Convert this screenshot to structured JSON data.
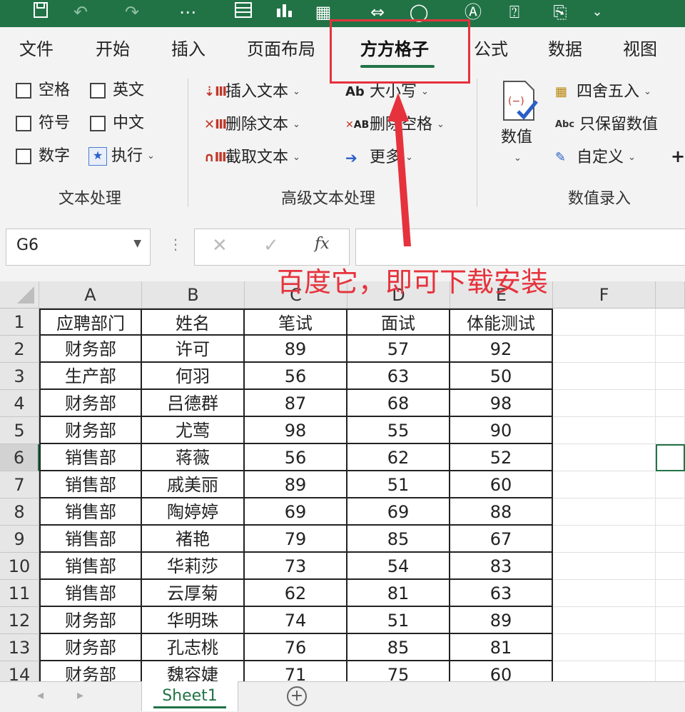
{
  "ribbon_tabs": [
    "文件",
    "开始",
    "插入",
    "页面布局",
    "方方格子",
    "公式",
    "数据",
    "视图"
  ],
  "active_tab": "方方格子",
  "ribbon": {
    "text_group": {
      "label": "文本处理",
      "checkboxes": [
        "空格",
        "英文",
        "符号",
        "中文",
        "数字"
      ],
      "execute_label": "执行"
    },
    "advanced_group": {
      "label": "高级文本处理",
      "insert_text": "插入文本",
      "delete_text": "删除文本",
      "extract_text": "截取文本",
      "case_label": "大小写",
      "delete_space": "删除空格",
      "more": "更多",
      "ab_glyph": "Ab",
      "ab_glyph2": "AB"
    },
    "number_group": {
      "label": "数值录入",
      "value_label": "数值",
      "round": "四舍五入",
      "keep_numbers": "只保留数值",
      "custom": "自定义",
      "plus": "+",
      "abc_glyph": "Abc"
    }
  },
  "name_box": "G6",
  "formula_bar": {
    "cancel": "✕",
    "confirm": "✓",
    "fx": "fx",
    "content": ""
  },
  "annotation": "百度它，即可下载安装",
  "columns": [
    "A",
    "B",
    "C",
    "D",
    "E",
    "F"
  ],
  "rows": [
    {
      "num": "1",
      "a": "应聘部门",
      "b": "姓名",
      "c": "笔试",
      "d": "面试",
      "e": "体能测试"
    },
    {
      "num": "2",
      "a": "财务部",
      "b": "许可",
      "c": "89",
      "d": "57",
      "e": "92"
    },
    {
      "num": "3",
      "a": "生产部",
      "b": "何羽",
      "c": "56",
      "d": "63",
      "e": "50"
    },
    {
      "num": "4",
      "a": "财务部",
      "b": "吕德群",
      "c": "87",
      "d": "68",
      "e": "98"
    },
    {
      "num": "5",
      "a": "财务部",
      "b": "尤莺",
      "c": "98",
      "d": "55",
      "e": "90"
    },
    {
      "num": "6",
      "a": "销售部",
      "b": "蒋薇",
      "c": "56",
      "d": "62",
      "e": "52"
    },
    {
      "num": "7",
      "a": "销售部",
      "b": "戚美丽",
      "c": "89",
      "d": "51",
      "e": "60"
    },
    {
      "num": "8",
      "a": "销售部",
      "b": "陶婷婷",
      "c": "69",
      "d": "69",
      "e": "88"
    },
    {
      "num": "9",
      "a": "销售部",
      "b": "褚艳",
      "c": "79",
      "d": "85",
      "e": "67"
    },
    {
      "num": "10",
      "a": "销售部",
      "b": "华莉莎",
      "c": "73",
      "d": "54",
      "e": "83"
    },
    {
      "num": "11",
      "a": "销售部",
      "b": "云厚菊",
      "c": "62",
      "d": "81",
      "e": "63"
    },
    {
      "num": "12",
      "a": "财务部",
      "b": "华明珠",
      "c": "74",
      "d": "51",
      "e": "89"
    },
    {
      "num": "13",
      "a": "财务部",
      "b": "孔志桃",
      "c": "76",
      "d": "85",
      "e": "81"
    },
    {
      "num": "14",
      "a": "财务部",
      "b": "魏容婕",
      "c": "71",
      "d": "75",
      "e": "60"
    }
  ],
  "sheet_tab": "Sheet1",
  "colors": {
    "accent": "#217346",
    "annotation": "#e6323c"
  }
}
